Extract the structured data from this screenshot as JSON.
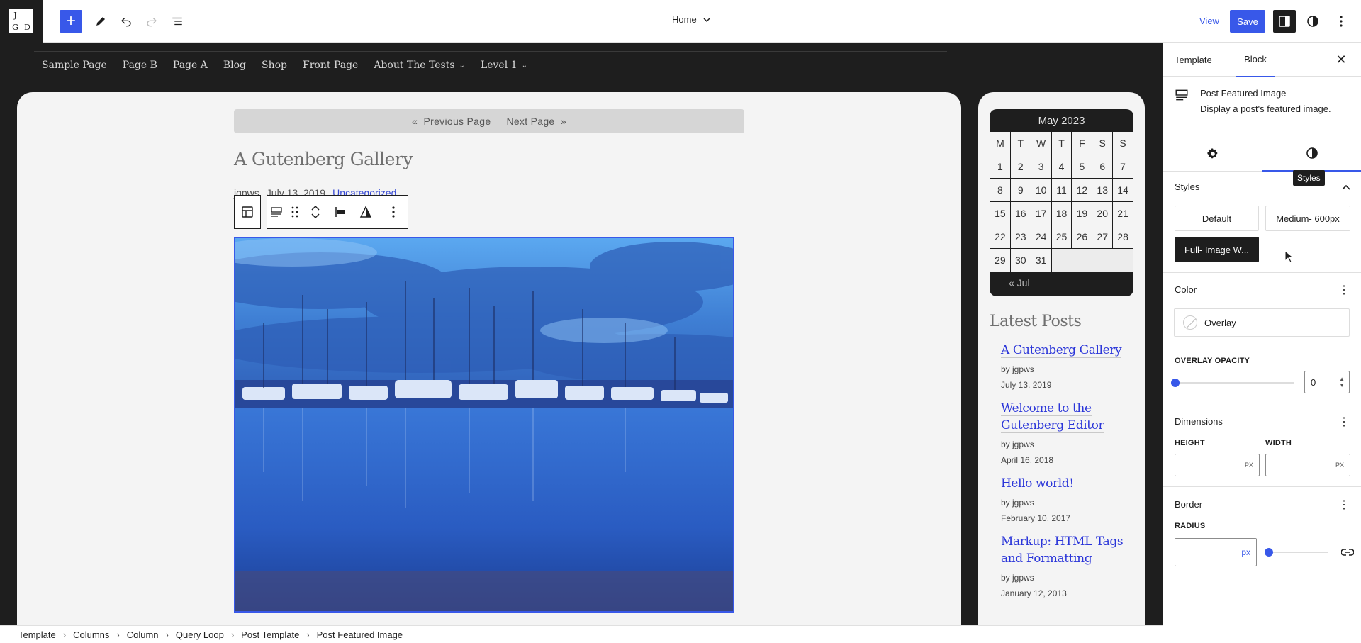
{
  "site_logo": {
    "letters": [
      "J",
      "G",
      "D",
      ""
    ]
  },
  "topbar": {
    "document_title": "Home",
    "view_label": "View",
    "save_label": "Save"
  },
  "navigation": {
    "items": [
      "Sample Page",
      "Page B",
      "Page A",
      "Blog",
      "Shop",
      "Front Page",
      "About The Tests",
      "Level 1"
    ]
  },
  "query_pagination": {
    "previous_label": "Previous Page",
    "next_label": "Next Page",
    "prev_arrow": "«",
    "next_arrow": "»"
  },
  "post": {
    "title": "A Gutenberg Gallery",
    "author": "jgpws",
    "date": "July 13, 2019",
    "category": "Uncategorized"
  },
  "calendar": {
    "title": "May 2023",
    "weekdays": [
      "M",
      "T",
      "W",
      "T",
      "F",
      "S",
      "S"
    ],
    "days": [
      "1",
      "2",
      "3",
      "4",
      "5",
      "6",
      "7",
      "8",
      "9",
      "10",
      "11",
      "12",
      "13",
      "14",
      "15",
      "16",
      "17",
      "18",
      "19",
      "20",
      "21",
      "22",
      "23",
      "24",
      "25",
      "26",
      "27",
      "28",
      "29",
      "30",
      "31"
    ],
    "prev_link": "« Jul"
  },
  "latest_posts": {
    "title": "Latest Posts",
    "items": [
      {
        "title": "A Gutenberg Gallery",
        "author": "by jgpws",
        "date": "July 13, 2019"
      },
      {
        "title": "Welcome to the Gutenberg Editor",
        "author": "by jgpws",
        "date": "April 16, 2018"
      },
      {
        "title": "Hello world!",
        "author": "by jgpws",
        "date": "February 10, 2017"
      },
      {
        "title": "Markup: HTML Tags and Formatting",
        "author": "by jgpws",
        "date": "January 12, 2013"
      }
    ]
  },
  "breadcrumbs": [
    "Template",
    "Columns",
    "Column",
    "Query Loop",
    "Post Template",
    "Post Featured Image"
  ],
  "sidebar": {
    "tabs": {
      "template": "Template",
      "block": "Block"
    },
    "block_name": "Post Featured Image",
    "block_description": "Display a post's featured image.",
    "styles": {
      "header": "Styles",
      "tooltip": "Styles",
      "options": [
        "Default",
        "Medium- 600px",
        "Full- Image W..."
      ],
      "active": "Full- Image W..."
    },
    "color": {
      "header": "Color",
      "overlay_label": "Overlay",
      "opacity_label": "OVERLAY OPACITY",
      "opacity_value": "0"
    },
    "dimensions": {
      "header": "Dimensions",
      "height_label": "HEIGHT",
      "width_label": "WIDTH",
      "unit": "PX"
    },
    "border": {
      "header": "Border",
      "radius_label": "RADIUS",
      "unit": "px"
    }
  },
  "colors": {
    "accent": "#3858e9",
    "canvas_bg": "#1e1e1e",
    "link": "#2b36d9"
  }
}
